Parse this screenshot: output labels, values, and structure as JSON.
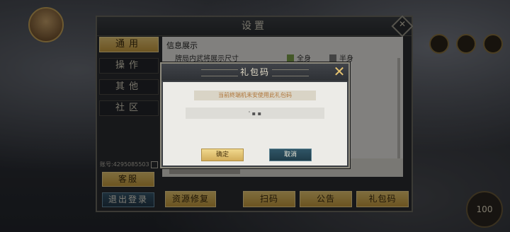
{
  "settings": {
    "title": "设置",
    "tabs": [
      {
        "label": "通用",
        "active": true
      },
      {
        "label": "操作",
        "active": false
      },
      {
        "label": "其他",
        "active": false
      },
      {
        "label": "社区",
        "active": false
      }
    ],
    "section_title": "信息展示",
    "display_row": {
      "label": "牌局内武将展示尺寸",
      "options": [
        {
          "label": "全身",
          "checked": true
        },
        {
          "label": "半身",
          "checked": false
        }
      ]
    },
    "account": "账号:4295085503",
    "service_button": "客服",
    "logout_button": "退出登录",
    "bottom_buttons": [
      "资源修复",
      "扫码",
      "公告",
      "礼包码"
    ]
  },
  "gift_dialog": {
    "title": "礼包码",
    "notice": "当前終端机未安使用此礼包码",
    "code_value": "' ▪ ▪",
    "confirm_label": "确定",
    "cancel_label": "取消"
  },
  "overlay_badge": "100",
  "colors": {
    "accent_gold": "#e6c670",
    "accent_blue": "#2f5566",
    "close_gold": "#e6c370"
  }
}
